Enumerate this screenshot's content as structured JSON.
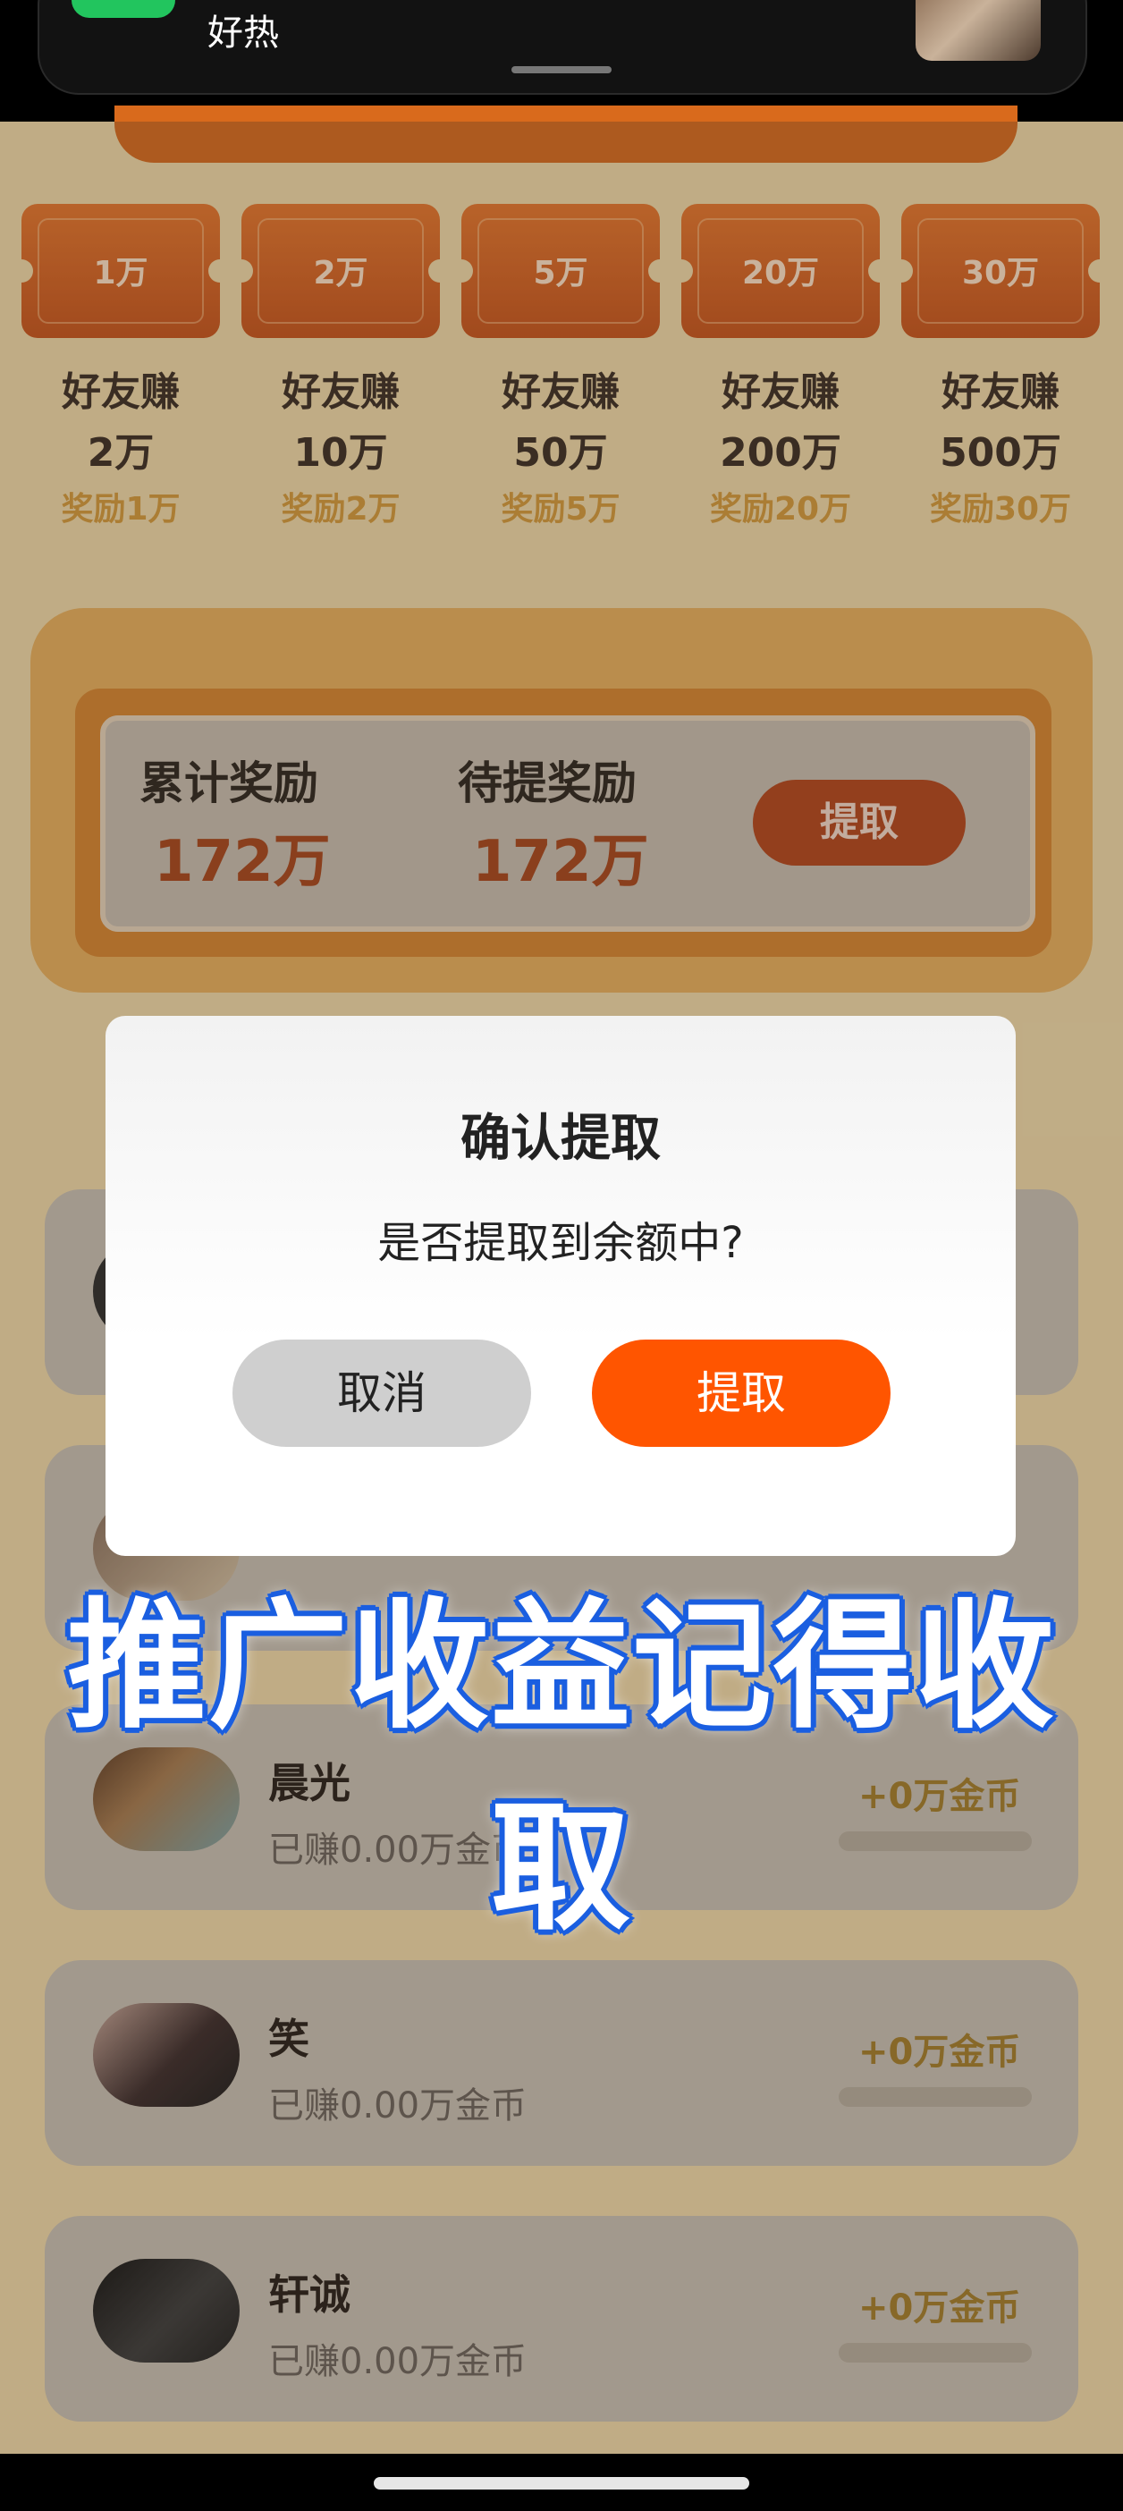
{
  "notification": {
    "text": "好热"
  },
  "tickets": [
    {
      "amount": "1万",
      "line1": "好友赚",
      "line2": "2万",
      "reward": "奖励1万"
    },
    {
      "amount": "2万",
      "line1": "好友赚",
      "line2": "10万",
      "reward": "奖励2万"
    },
    {
      "amount": "5万",
      "line1": "好友赚",
      "line2": "50万",
      "reward": "奖励5万"
    },
    {
      "amount": "20万",
      "line1": "好友赚",
      "line2": "200万",
      "reward": "奖励20万"
    },
    {
      "amount": "30万",
      "line1": "好友赚",
      "line2": "500万",
      "reward": "奖励30万"
    }
  ],
  "summary": {
    "total_label": "累计奖励",
    "total_value": "172万",
    "pending_label": "待提奖励",
    "pending_value": "172万",
    "withdraw_label": "提取"
  },
  "list": [
    {
      "name": "晨光",
      "earned": "已赚0.00万金币",
      "coins": "+0万金币"
    },
    {
      "name": "笑",
      "earned": "已赚0.00万金币",
      "coins": "+0万金币"
    },
    {
      "name": "轩诚",
      "earned": "已赚0.00万金币",
      "coins": "+0万金币"
    }
  ],
  "dialog": {
    "title": "确认提取",
    "message": "是否提取到余额中?",
    "cancel_label": "取消",
    "confirm_label": "提取"
  },
  "caption": "推广收益记得收取",
  "colors": {
    "accent": "#ff5500",
    "caption_outline": "#1b5fe0",
    "reward_text": "#a8451a"
  }
}
